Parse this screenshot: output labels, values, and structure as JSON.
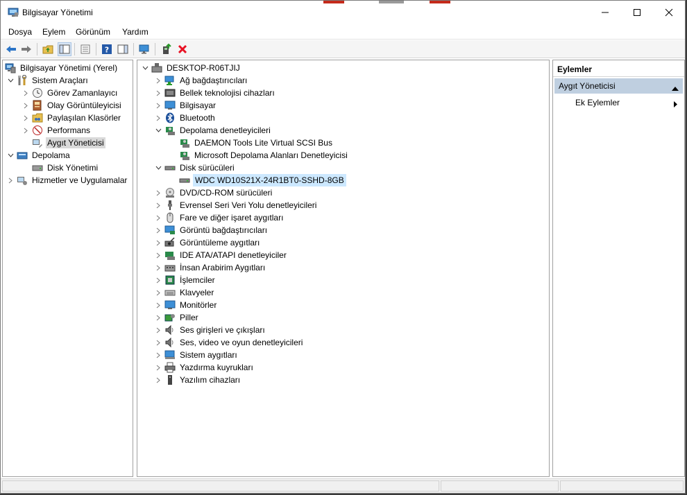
{
  "window": {
    "title": "Bilgisayar Yönetimi"
  },
  "menubar": {
    "items": [
      "Dosya",
      "Eylem",
      "Görünüm",
      "Yardım"
    ]
  },
  "left_tree": {
    "root": "Bilgisayar Yönetimi (Yerel)",
    "system_tools": "Sistem Araçları",
    "task_scheduler": "Görev Zamanlayıcı",
    "event_viewer": "Olay Görüntüleyicisi",
    "shared_folders": "Paylaşılan Klasörler",
    "performance": "Performans",
    "device_manager": "Aygıt Yöneticisi",
    "storage": "Depolama",
    "disk_management": "Disk Yönetimi",
    "services": "Hizmetler ve Uygulamalar"
  },
  "device_tree": {
    "computer": "DESKTOP-R06TJIJ",
    "categories": [
      "Ağ bağdaştırıcıları",
      "Bellek teknolojisi cihazları",
      "Bilgisayar",
      "Bluetooth",
      "Depolama denetleyicileri",
      "DAEMON Tools Lite Virtual SCSI Bus",
      "Microsoft Depolama Alanları Denetleyicisi",
      "Disk sürücüleri",
      "WDC WD10S21X-24R1BT0-SSHD-8GB",
      "DVD/CD-ROM sürücüleri",
      "Evrensel Seri Veri Yolu denetleyicileri",
      "Fare ve diğer işaret aygıtları",
      "Görüntü bağdaştırıcıları",
      "Görüntüleme aygıtları",
      "IDE ATA/ATAPI denetleyiciler",
      "İnsan Arabirim Aygıtları",
      "İşlemciler",
      "Klavyeler",
      "Monitörler",
      "Piller",
      "Ses girişleri ve çıkışları",
      "Ses, video ve oyun denetleyicileri",
      "Sistem aygıtları",
      "Yazdırma kuyrukları",
      "Yazılım cihazları"
    ]
  },
  "actions": {
    "header": "Eylemler",
    "section": "Aygıt Yöneticisi",
    "more": "Ek Eylemler"
  },
  "colors": {
    "selection_blue": "#cce8ff",
    "section_bg": "#bfcfe0",
    "delete_red": "#e81123"
  }
}
